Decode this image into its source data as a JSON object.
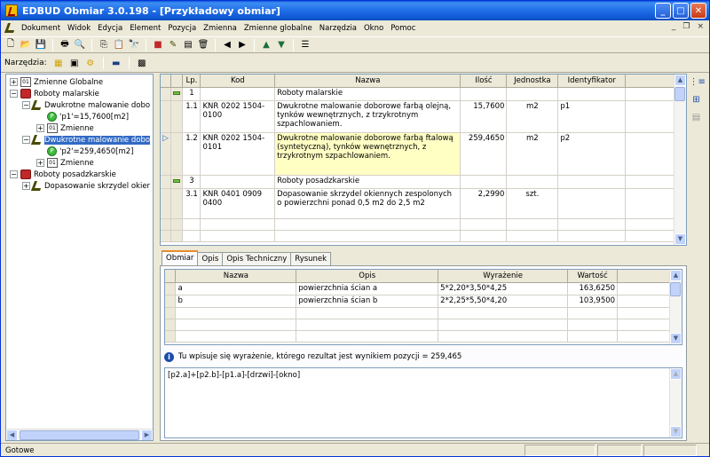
{
  "window": {
    "title": "EDBUD Obmiar 3.0.198 - [Przykładowy obmiar]",
    "min": "_",
    "max": "□",
    "close": "✕"
  },
  "menu": [
    "Dokument",
    "Widok",
    "Edycja",
    "Element",
    "Pozycja",
    "Zmienna",
    "Zmienne globalne",
    "Narzędzia",
    "Okno",
    "Pomoc"
  ],
  "mdi": {
    "min": "_",
    "restore": "❐",
    "close": "×"
  },
  "toolbar2": {
    "label": "Narzędzia:"
  },
  "tree": {
    "n0": "Zmienne Globalne",
    "n1": "Roboty malarskie",
    "n2": "Dwukrotne malowanie dobo",
    "n3": "'p1'=15,7600[m2]",
    "n4": "Zmienne",
    "n5": "Dwukrotne malowanie dobo",
    "n6": "'p2'=259,4650[m2]",
    "n7": "Zmienne",
    "n8": "Roboty posadzkarskie",
    "n9": "Dopasowanie skrzydel okier"
  },
  "grid": {
    "headers": {
      "lp": "Lp.",
      "kod": "Kod",
      "nazwa": "Nazwa",
      "ilosc": "Ilość",
      "jednostka": "Jednostka",
      "id": "Identyfikator"
    },
    "r1": {
      "lp": "1",
      "nazwa": "Roboty malarskie"
    },
    "r2": {
      "lp": "1.1",
      "kod": "KNR 0202 1504-0100",
      "nazwa": "Dwukrotne malowanie doborowe farbą olejną, tynków wewnętrznych, z trzykrotnym szpachlowaniem.",
      "ilosc": "15,7600",
      "jm": "m2",
      "id": "p1"
    },
    "r3": {
      "lp": "1.2",
      "kod": "KNR 0202 1504-0101",
      "nazwa": "Dwukrotne malowanie doborowe farbą ftalową (syntetyczną), tynków wewnętrznych, z trzykrotnym szpachlowaniem.",
      "ilosc": "259,4650",
      "jm": "m2",
      "id": "p2"
    },
    "r4": {
      "lp": "3",
      "nazwa": "Roboty posadzkarskie"
    },
    "r5": {
      "lp": "3.1",
      "kod": "KNR 0401 0909 0400",
      "nazwa": "Dopasowanie skrzydel okiennych zespolonych o powierzchni ponad 0,5 m2 do 2,5 m2",
      "ilosc": "2,2990",
      "jm": "szt."
    }
  },
  "tabs": {
    "t1": "Obmiar",
    "t2": "Opis",
    "t3": "Opis Techniczny",
    "t4": "Rysunek"
  },
  "vars": {
    "headers": {
      "nazwa": "Nazwa",
      "opis": "Opis",
      "wyr": "Wyrażenie",
      "wart": "Wartość"
    },
    "r1": {
      "nazwa": "a",
      "opis": "powierzchnia ścian a",
      "wyr": "5*2,20*3,50*4,25",
      "wart": "163,6250"
    },
    "r2": {
      "nazwa": "b",
      "opis": "powierzchnia ścian b",
      "wyr": "2*2,25*5,50*4,20",
      "wart": "103,9500"
    }
  },
  "info": "Tu wpisuje się wyrażenie, którego rezultat jest wynikiem pozycji = 259,465",
  "expression": "[p2.a]+[p2.b]-[p1.a]-[drzwi]-[okno]",
  "status": "Gotowe"
}
